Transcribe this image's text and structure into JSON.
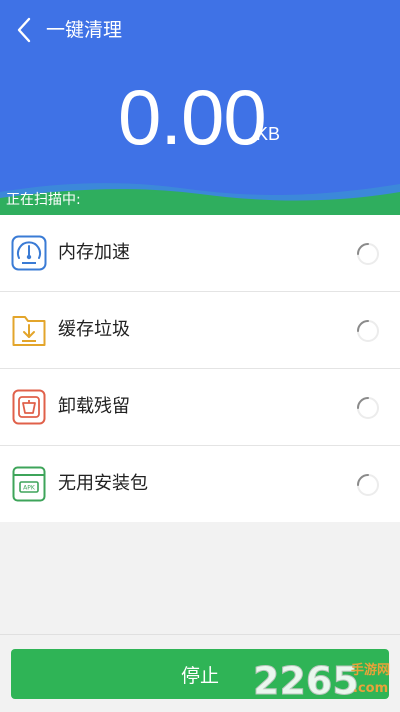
{
  "header": {
    "title": "一键清理",
    "value": "0.00",
    "unit": "KB",
    "scan_label": "正在扫描中:"
  },
  "list": {
    "items": [
      {
        "label": "内存加速",
        "icon": "speedometer-icon",
        "color": "#3a7bd5"
      },
      {
        "label": "缓存垃圾",
        "icon": "download-folder-icon",
        "color": "#e3a52b"
      },
      {
        "label": "卸载残留",
        "icon": "uninstall-box-icon",
        "color": "#e0604a"
      },
      {
        "label": "无用安装包",
        "icon": "apk-package-icon",
        "color": "#3ea45a"
      }
    ]
  },
  "footer": {
    "stop_label": "停止"
  },
  "watermark": {
    "number": "2265",
    "site": "手游网",
    "domain": ".com"
  },
  "colors": {
    "header_bg": "#3f72e6",
    "wave_green": "#2fae5e",
    "button_green": "#2fb456"
  }
}
